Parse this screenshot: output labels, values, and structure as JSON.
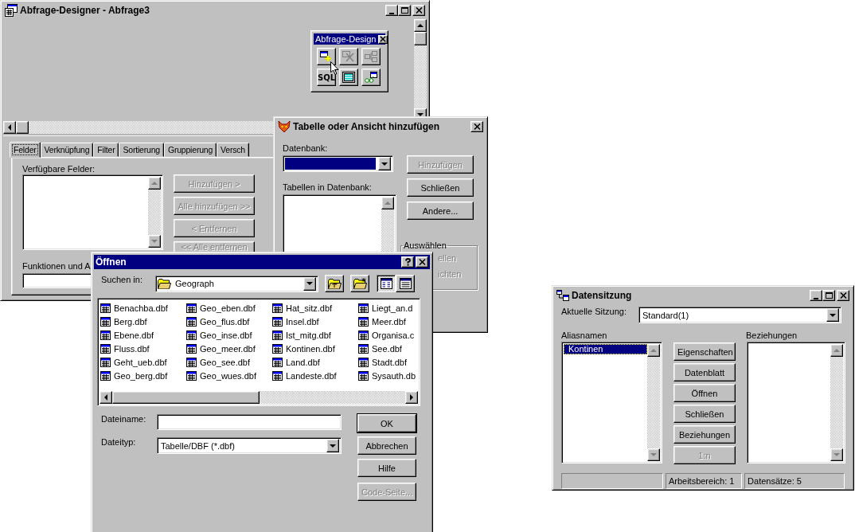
{
  "designer": {
    "title": "Abfrage-Designer - Abfrage3",
    "active": false,
    "palette": {
      "title": "Abfrage-Design",
      "active": true,
      "tools": [
        {
          "disabled": false
        },
        {
          "disabled": true
        },
        {
          "disabled": true
        },
        {
          "label": "SQL",
          "disabled": false
        },
        {
          "disabled": false
        },
        {
          "disabled": false
        }
      ]
    },
    "tabs": [
      {
        "label": "Felder",
        "selected": true
      },
      {
        "label": "Verknüpfung",
        "selected": false
      },
      {
        "label": "Filter",
        "selected": false
      },
      {
        "label": "Sortierung",
        "selected": false
      },
      {
        "label": "Gruppierung",
        "selected": false
      },
      {
        "label": "Versch",
        "selected": false
      }
    ],
    "available_fields_label": "Verfügbare Felder:",
    "buttons": [
      {
        "label": "Hinzufügen >",
        "disabled": true
      },
      {
        "label": "Alle hinzufügen >>",
        "disabled": true
      },
      {
        "label": "< Entfernen",
        "disabled": true
      },
      {
        "label": "<< Alle entfernen",
        "disabled": true
      }
    ],
    "functions_label": "Funktionen und A"
  },
  "add_table_dialog": {
    "title": "Tabelle oder Ansicht hinzufügen",
    "active": false,
    "database_label": "Datenbank:",
    "tables_label": "Tabellen in Datenbank:",
    "buttons": [
      {
        "label": "Hinzufügen",
        "disabled": true
      },
      {
        "label": "Schließen",
        "disabled": false
      },
      {
        "label": "Andere...",
        "disabled": false
      }
    ],
    "select_group": {
      "title": "Auswählen",
      "options": [
        {
          "label": "ellen",
          "disabled": true
        },
        {
          "label": "ichten",
          "disabled": true
        }
      ]
    }
  },
  "open_dialog": {
    "title": "Öffnen",
    "active": true,
    "look_in_label": "Suchen in:",
    "look_in": "Geograph",
    "view_modes": [
      {
        "selected": true
      },
      {
        "selected": false
      }
    ],
    "files": [
      "Benachba.dbf",
      "Berg.dbf",
      "Ebene.dbf",
      "Fluss.dbf",
      "Geht_ueb.dbf",
      "Geo_berg.dbf",
      "Geo_eben.dbf",
      "Geo_flus.dbf",
      "Geo_inse.dbf",
      "Geo_meer.dbf",
      "Geo_see.dbf",
      "Geo_wues.dbf",
      "Hat_sitz.dbf",
      "Insel.dbf",
      "Ist_mitg.dbf",
      "Kontinen.dbf",
      "Land.dbf",
      "Landeste.dbf",
      "Liegt_an.d",
      "Meer.dbf",
      "Organisa.c",
      "See.dbf",
      "Stadt.dbf",
      "Sysauth.db"
    ],
    "filename_label": "Dateiname:",
    "filetype_label": "Dateityp:",
    "filetype": "Tabelle/DBF (*.dbf)",
    "buttons": [
      {
        "label": "OK",
        "disabled": false,
        "default": true
      },
      {
        "label": "Abbrechen",
        "disabled": false,
        "default": false
      },
      {
        "label": "Hilfe",
        "disabled": false,
        "default": false
      },
      {
        "label": "Code-Seite...",
        "disabled": true,
        "default": false
      }
    ]
  },
  "session_window": {
    "title": "Datensitzung",
    "active": false,
    "current_session_label": "Aktuelle Sitzung:",
    "current_session": "Standard(1)",
    "aliases_label": "Aliasnamen",
    "aliases": [
      {
        "label": "Kontinen",
        "selected": true
      }
    ],
    "buttons": [
      {
        "label": "Eigenschaften",
        "disabled": false
      },
      {
        "label": "Datenblatt",
        "disabled": false
      },
      {
        "label": "Öffnen",
        "disabled": false
      },
      {
        "label": "Schließen",
        "disabled": false
      },
      {
        "label": "Beziehungen",
        "disabled": false
      },
      {
        "label": "1:n",
        "disabled": true
      }
    ],
    "relations_label": "Beziehungen",
    "status": [
      "Arbeitsbereich: 1",
      "Datensätze: 5"
    ]
  }
}
